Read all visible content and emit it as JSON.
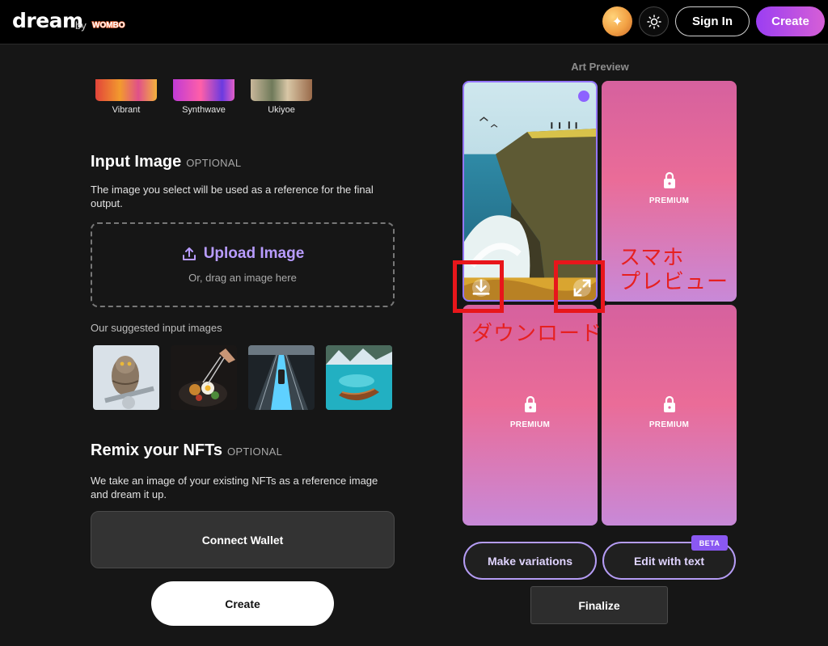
{
  "header": {
    "logo": "dream",
    "by": "by",
    "brand": "WOMBO",
    "signin_label": "Sign In",
    "create_label": "Create"
  },
  "styles": [
    {
      "label": "Vibrant"
    },
    {
      "label": "Synthwave"
    },
    {
      "label": "Ukiyoe"
    }
  ],
  "input_image": {
    "title": "Input Image",
    "optional": "OPTIONAL",
    "description": "The image you select will be used as a reference for the final output.",
    "upload_label": "Upload Image",
    "upload_sub": "Or, drag an image here",
    "suggested_label": "Our suggested input images"
  },
  "remix": {
    "title": "Remix your NFTs",
    "optional": "OPTIONAL",
    "description": "We take an image of your existing NFTs as a reference image and dream it up.",
    "connect_label": "Connect Wallet"
  },
  "create_button": "Create",
  "preview": {
    "title": "Art Preview",
    "premium_label": "PREMIUM",
    "make_variations": "Make variations",
    "edit_with_text": "Edit with text",
    "beta": "BETA",
    "finalize": "Finalize"
  },
  "annotations": {
    "phone_preview": "スマホ\nプレビュー",
    "download": "ダウンロード"
  },
  "colors": {
    "accent": "#b89cff",
    "selection": "#9475ff",
    "create_gradient_start": "#9b3ef2",
    "create_gradient_end": "#d65fd6",
    "annotation_red": "#e8161b"
  }
}
